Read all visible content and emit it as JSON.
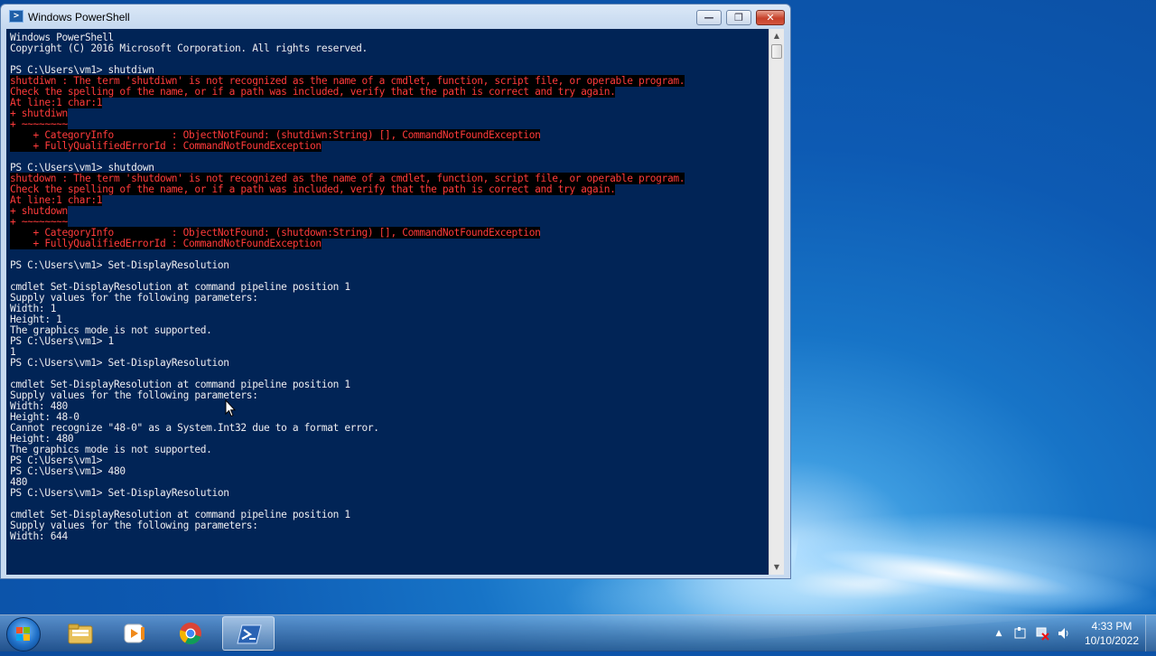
{
  "window": {
    "title": "Windows PowerShell",
    "buttons": {
      "minimize": "—",
      "maximize": "❐",
      "close": "✕"
    }
  },
  "console": {
    "lines": [
      {
        "text": "Windows PowerShell",
        "err": false
      },
      {
        "text": "Copyright (C) 2016 Microsoft Corporation. All rights reserved.",
        "err": false
      },
      {
        "text": "",
        "err": false
      },
      {
        "text": "PS C:\\Users\\vm1> shutdiwn",
        "err": false
      },
      {
        "text": "shutdiwn : The term 'shutdiwn' is not recognized as the name of a cmdlet, function, script file, or operable program.",
        "err": true
      },
      {
        "text": "Check the spelling of the name, or if a path was included, verify that the path is correct and try again.",
        "err": true
      },
      {
        "text": "At line:1 char:1",
        "err": true
      },
      {
        "text": "+ shutdiwn",
        "err": true
      },
      {
        "text": "+ ~~~~~~~~",
        "err": true
      },
      {
        "text": "    + CategoryInfo          : ObjectNotFound: (shutdiwn:String) [], CommandNotFoundException",
        "err": true
      },
      {
        "text": "    + FullyQualifiedErrorId : CommandNotFoundException",
        "err": true
      },
      {
        "text": "",
        "err": false
      },
      {
        "text": "PS C:\\Users\\vm1> shutdown",
        "err": false
      },
      {
        "text": "shutdown : The term 'shutdown' is not recognized as the name of a cmdlet, function, script file, or operable program.",
        "err": true
      },
      {
        "text": "Check the spelling of the name, or if a path was included, verify that the path is correct and try again.",
        "err": true
      },
      {
        "text": "At line:1 char:1",
        "err": true
      },
      {
        "text": "+ shutdown",
        "err": true
      },
      {
        "text": "+ ~~~~~~~~",
        "err": true
      },
      {
        "text": "    + CategoryInfo          : ObjectNotFound: (shutdown:String) [], CommandNotFoundException",
        "err": true
      },
      {
        "text": "    + FullyQualifiedErrorId : CommandNotFoundException",
        "err": true
      },
      {
        "text": "",
        "err": false
      },
      {
        "text": "PS C:\\Users\\vm1> Set-DisplayResolution",
        "err": false
      },
      {
        "text": "",
        "err": false
      },
      {
        "text": "cmdlet Set-DisplayResolution at command pipeline position 1",
        "err": false
      },
      {
        "text": "Supply values for the following parameters:",
        "err": false
      },
      {
        "text": "Width: 1",
        "err": false
      },
      {
        "text": "Height: 1",
        "err": false
      },
      {
        "text": "The graphics mode is not supported.",
        "err": false
      },
      {
        "text": "PS C:\\Users\\vm1> 1",
        "err": false
      },
      {
        "text": "1",
        "err": false
      },
      {
        "text": "PS C:\\Users\\vm1> Set-DisplayResolution",
        "err": false
      },
      {
        "text": "",
        "err": false
      },
      {
        "text": "cmdlet Set-DisplayResolution at command pipeline position 1",
        "err": false
      },
      {
        "text": "Supply values for the following parameters:",
        "err": false
      },
      {
        "text": "Width: 480",
        "err": false
      },
      {
        "text": "Height: 48-0",
        "err": false
      },
      {
        "text": "Cannot recognize \"48-0\" as a System.Int32 due to a format error.",
        "err": false
      },
      {
        "text": "Height: 480",
        "err": false
      },
      {
        "text": "The graphics mode is not supported.",
        "err": false
      },
      {
        "text": "PS C:\\Users\\vm1>",
        "err": false
      },
      {
        "text": "PS C:\\Users\\vm1> 480",
        "err": false
      },
      {
        "text": "480",
        "err": false
      },
      {
        "text": "PS C:\\Users\\vm1> Set-DisplayResolution",
        "err": false
      },
      {
        "text": "",
        "err": false
      },
      {
        "text": "cmdlet Set-DisplayResolution at command pipeline position 1",
        "err": false
      },
      {
        "text": "Supply values for the following parameters:",
        "err": false
      },
      {
        "text": "Width: 644",
        "err": false
      }
    ]
  },
  "taskbar": {
    "apps": [
      {
        "name": "windows-explorer",
        "icon": "folder-icon",
        "active": false
      },
      {
        "name": "media-player",
        "icon": "media-player-icon",
        "active": false
      },
      {
        "name": "chrome",
        "icon": "chrome-icon",
        "active": false
      },
      {
        "name": "powershell",
        "icon": "powershell-icon",
        "active": true
      }
    ],
    "tray": {
      "icons": [
        "show-hidden-icons-icon",
        "action-center-icon",
        "network-icon",
        "volume-icon"
      ],
      "time": "4:33 PM",
      "date": "10/10/2022"
    }
  },
  "colors": {
    "console_bg": "#012456",
    "console_fg": "#eeedf0",
    "error_fg": "#ff3b3b",
    "error_bg": "#000000"
  }
}
